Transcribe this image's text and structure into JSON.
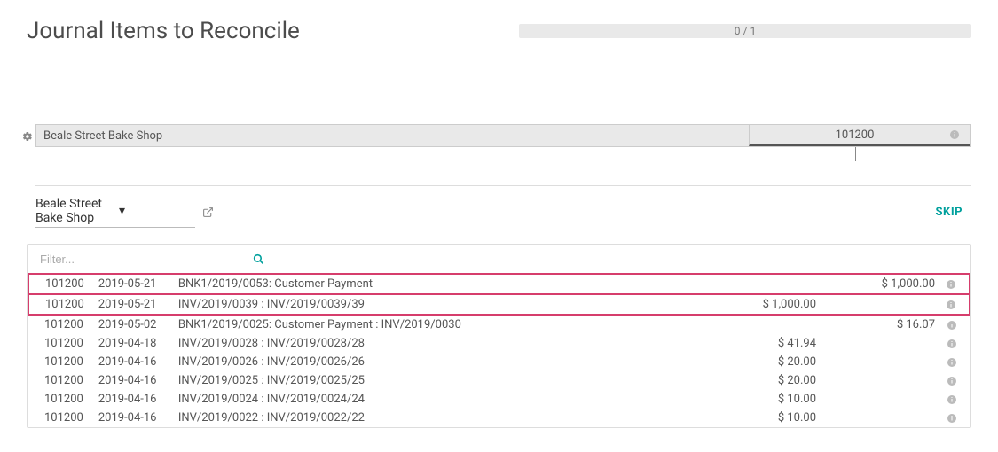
{
  "header": {
    "title": "Journal Items to Reconcile",
    "progress": "0 / 1"
  },
  "partner_bar": {
    "name": "Beale Street Bake Shop",
    "account": "101200"
  },
  "edit_row": {
    "partner": "Beale Street Bake Shop",
    "skip_label": "SKIP"
  },
  "filter": {
    "placeholder": "Filter..."
  },
  "rows": [
    {
      "code": "101200",
      "date": "2019-05-21",
      "desc": "BNK1/2019/0053: Customer Payment",
      "debit": "",
      "credit": "$ 1,000.00"
    },
    {
      "code": "101200",
      "date": "2019-05-21",
      "desc": "INV/2019/0039 : INV/2019/0039/39",
      "debit": "$ 1,000.00",
      "credit": ""
    },
    {
      "code": "101200",
      "date": "2019-05-02",
      "desc": "BNK1/2019/0025: Customer Payment : INV/2019/0030",
      "debit": "",
      "credit": "$ 16.07"
    },
    {
      "code": "101200",
      "date": "2019-04-18",
      "desc": "INV/2019/0028 : INV/2019/0028/28",
      "debit": "$ 41.94",
      "credit": ""
    },
    {
      "code": "101200",
      "date": "2019-04-16",
      "desc": "INV/2019/0026 : INV/2019/0026/26",
      "debit": "$ 20.00",
      "credit": ""
    },
    {
      "code": "101200",
      "date": "2019-04-16",
      "desc": "INV/2019/0025 : INV/2019/0025/25",
      "debit": "$ 20.00",
      "credit": ""
    },
    {
      "code": "101200",
      "date": "2019-04-16",
      "desc": "INV/2019/0024 : INV/2019/0024/24",
      "debit": "$ 10.00",
      "credit": ""
    },
    {
      "code": "101200",
      "date": "2019-04-16",
      "desc": "INV/2019/0022 : INV/2019/0022/22",
      "debit": "$ 10.00",
      "credit": ""
    }
  ]
}
